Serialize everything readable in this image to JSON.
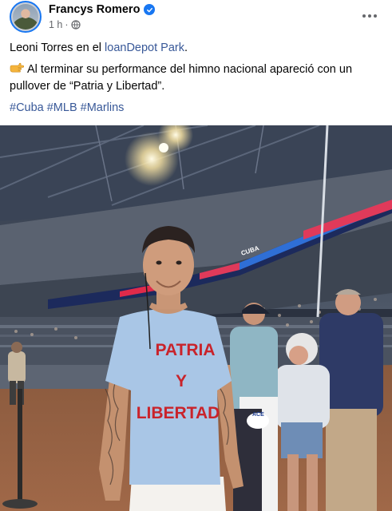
{
  "post": {
    "author": "Francys Romero",
    "time": "1 h",
    "separator": "·",
    "verified_icon": "verified-badge-icon",
    "privacy_icon": "globe-icon",
    "more_icon": "more-options-icon",
    "text": {
      "line1_prefix": "Leoni Torres en el ",
      "line1_link": "loanDepot Park",
      "line1_suffix": ".",
      "line2": "Al terminar su performance del himno nacional apareció con un",
      "line3": "pullover de “Patria y Libertad”.",
      "point_icon": "pointing-right-emoji-icon"
    },
    "hashtags": [
      "#Cuba",
      "#MLB",
      "#Marlins"
    ]
  },
  "photo": {
    "shirt_text": [
      "PATRIA",
      "Y",
      "LIBERTAD"
    ],
    "ribbon_text": "CUBA",
    "badge_text": "ACE"
  },
  "colors": {
    "link": "#385898",
    "verified": "#1877f2",
    "secondary_text": "#65676b",
    "shirt": "#a9c6e6",
    "shirt_text": "#c9232b"
  }
}
